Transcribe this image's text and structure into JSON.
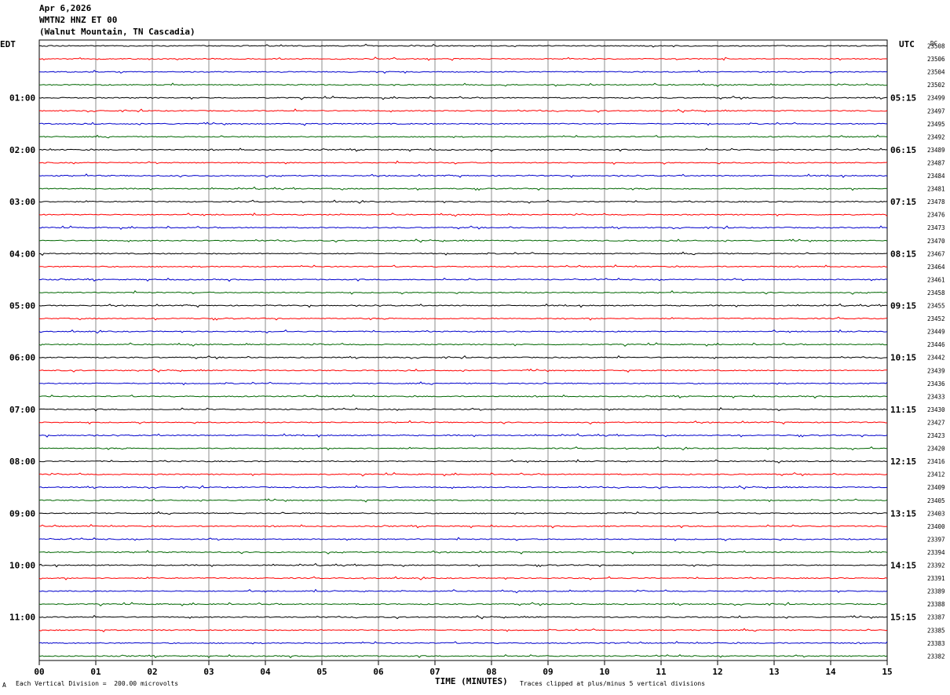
{
  "header": {
    "date": "Apr 6,2026",
    "channel": "WMTN2 HNZ ET 00",
    "station": "(Walnut Mountain, TN Cascadia)"
  },
  "footer": {
    "left_mark": "A",
    "scale_note": "Each Vertical Division =  200.00 microvolts",
    "clip_note": "Traces clipped at plus/minus 5 vertical divisions",
    "x_title": "TIME (MINUTES)"
  },
  "chart_data": {
    "type": "line",
    "title": "",
    "xlabel": "TIME (MINUTES)",
    "xlim": [
      0,
      15
    ],
    "x_tick_labels": [
      "00",
      "01",
      "02",
      "03",
      "04",
      "05",
      "06",
      "07",
      "08",
      "09",
      "10",
      "11",
      "12",
      "13",
      "14",
      "15"
    ],
    "left_axis_title": "EDT",
    "right_axis_title": "UTC",
    "dc_header": "DC",
    "left_time_labels": [
      "01:00",
      "02:00",
      "03:00",
      "04:00",
      "05:00",
      "06:00",
      "07:00",
      "08:00",
      "09:00",
      "10:00",
      "11:00"
    ],
    "right_time_labels": [
      "05:15",
      "06:15",
      "07:15",
      "08:15",
      "09:15",
      "10:15",
      "11:15",
      "12:15",
      "13:15",
      "14:15",
      "15:15"
    ],
    "time_label_rows": [
      4,
      8,
      12,
      16,
      20,
      24,
      28,
      32,
      36,
      40,
      44
    ],
    "trace_colors": [
      "#000000",
      "#ff0000",
      "#0000cc",
      "#006600"
    ],
    "dc_offsets": [
      23508,
      23506,
      23504,
      23502,
      23499,
      23497,
      23495,
      23492,
      23489,
      23487,
      23484,
      23481,
      23478,
      23476,
      23473,
      23470,
      23467,
      23464,
      23461,
      23458,
      23455,
      23452,
      23449,
      23446,
      23442,
      23439,
      23436,
      23433,
      23430,
      23427,
      23423,
      23420,
      23416,
      23412,
      23409,
      23405,
      23403,
      23400,
      23397,
      23394,
      23392,
      23391,
      23389,
      23388,
      23387,
      23385,
      23383,
      23382
    ]
  }
}
